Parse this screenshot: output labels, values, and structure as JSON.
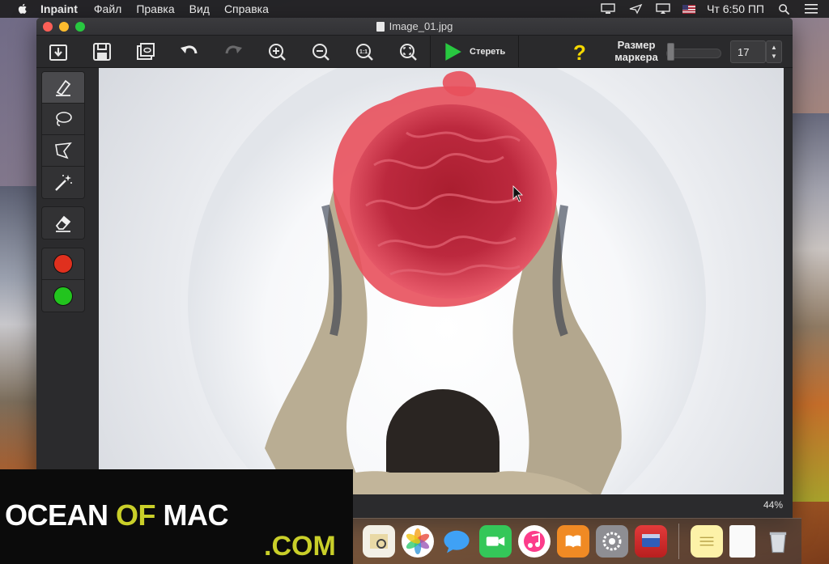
{
  "menubar": {
    "app_name": "Inpaint",
    "items": [
      "Файл",
      "Правка",
      "Вид",
      "Справка"
    ],
    "clock": "Чт 6:50 ПП"
  },
  "window": {
    "title": "Image_01.jpg"
  },
  "toolbar": {
    "erase_label": "Стереть",
    "help_label": "?",
    "marker_size_label_1": "Размер",
    "marker_size_label_2": "маркера",
    "marker_size_value": "17",
    "marker_size_fraction": 0.05
  },
  "sidebar": {
    "colors": [
      "#e0301e",
      "#22c41e"
    ]
  },
  "canvas": {
    "zoom_label": "44%"
  },
  "watermark": {
    "line1_a": "OCEAN",
    "line1_b": "OF",
    "line1_c": "MAC",
    "line2": ".COM"
  },
  "colors": {
    "accent_green": "#28c840",
    "help_yellow": "#f5d800",
    "selection_red": "#e8323c"
  }
}
